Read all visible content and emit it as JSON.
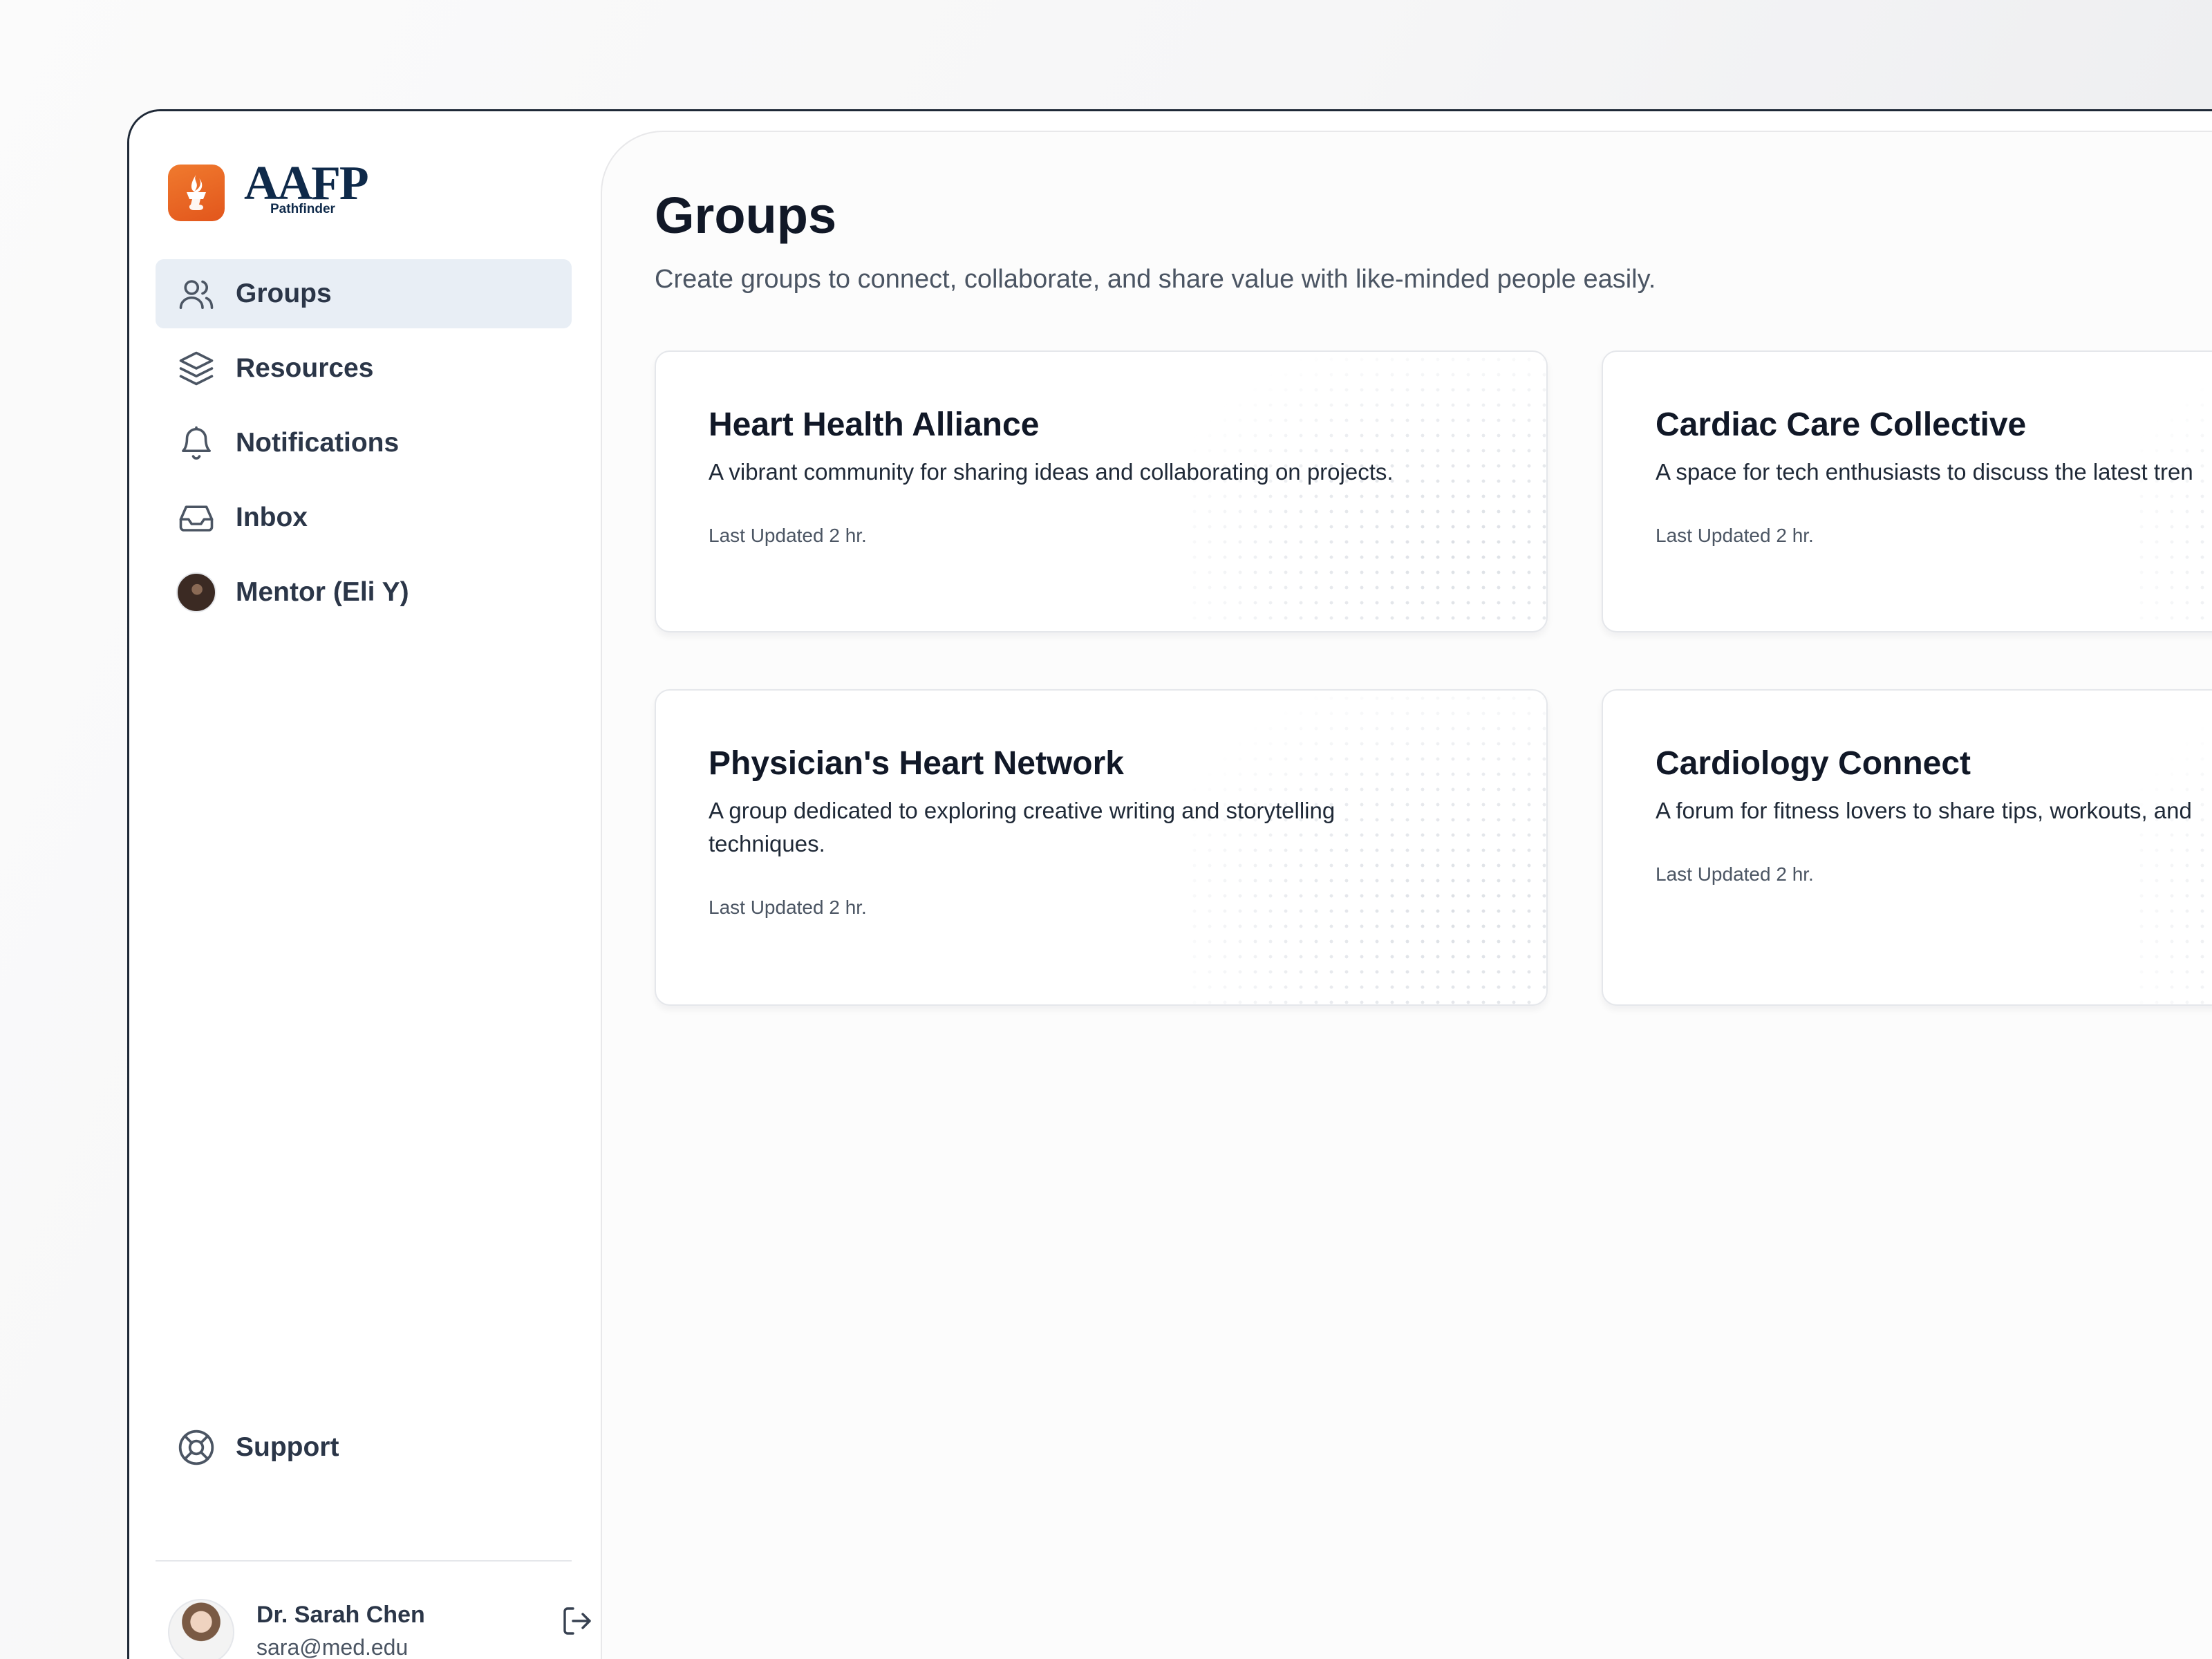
{
  "brand": {
    "wordmark": "AAFP",
    "sub": "Pathfinder",
    "accent_color": "#E8601F"
  },
  "sidebar": {
    "items": [
      {
        "label": "Groups",
        "icon": "users-icon",
        "active": true
      },
      {
        "label": "Resources",
        "icon": "layers-icon",
        "active": false
      },
      {
        "label": "Notifications",
        "icon": "bell-icon",
        "active": false
      },
      {
        "label": "Inbox",
        "icon": "inbox-icon",
        "active": false
      },
      {
        "label": "Mentor (Eli Y)",
        "icon": "mentor-avatar",
        "active": false
      }
    ],
    "support_label": "Support",
    "user": {
      "name": "Dr. Sarah Chen",
      "email": "sara@med.edu"
    }
  },
  "main": {
    "title": "Groups",
    "subtitle": "Create groups to connect, collaborate, and share value with like-minded people easily.",
    "groups": [
      {
        "title": "Heart Health Alliance",
        "description": "A vibrant community for sharing ideas and collaborating on projects.",
        "updated": "Last Updated 2 hr."
      },
      {
        "title": "Cardiac Care Collective",
        "description": "A space for tech enthusiasts to discuss the latest tren",
        "updated": "Last Updated 2 hr."
      },
      {
        "title": "Physician's Heart Network",
        "description": "A group dedicated to exploring creative writing and storytelling techniques.",
        "updated": "Last Updated 2 hr."
      },
      {
        "title": "Cardiology Connect",
        "description": "A forum for fitness lovers to share tips, workouts, and",
        "updated": "Last Updated 2 hr."
      }
    ]
  }
}
